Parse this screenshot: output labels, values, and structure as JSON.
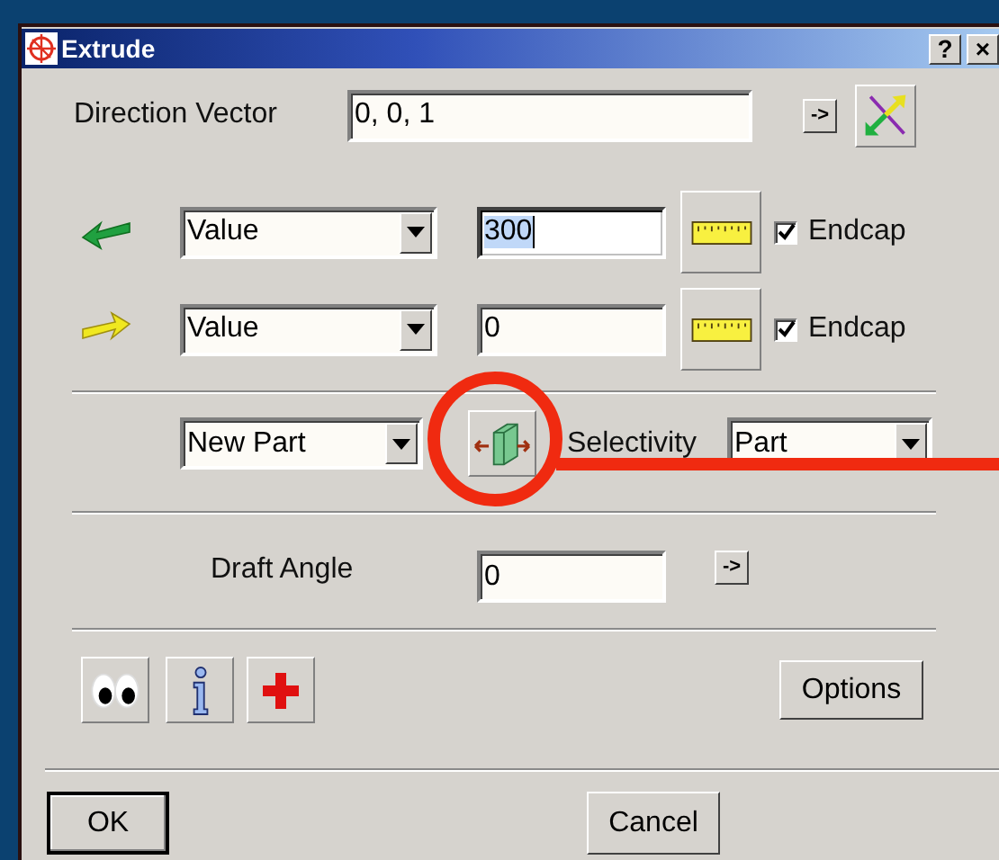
{
  "window": {
    "title": "Extrude",
    "help_button": "?",
    "close_button": "×"
  },
  "direction_vector": {
    "label": "Direction Vector",
    "value": "0, 0, 1",
    "arrow_button": "->"
  },
  "limits": [
    {
      "kind": "start",
      "method": "Value",
      "value": "300",
      "value_selected": true,
      "endcap": {
        "label": "Endcap",
        "checked": true
      }
    },
    {
      "kind": "end",
      "method": "Value",
      "value": "0",
      "value_selected": false,
      "endcap": {
        "label": "Endcap",
        "checked": true
      }
    }
  ],
  "operation": {
    "value": "New Part"
  },
  "selectivity": {
    "label": "Selectivity",
    "value": "Part"
  },
  "draft_angle": {
    "label": "Draft Angle",
    "value": "0",
    "arrow_button": "->"
  },
  "options_button": "Options",
  "buttons": [
    {
      "label": "OK",
      "default": true
    },
    {
      "label": "Cancel",
      "default": false
    }
  ]
}
